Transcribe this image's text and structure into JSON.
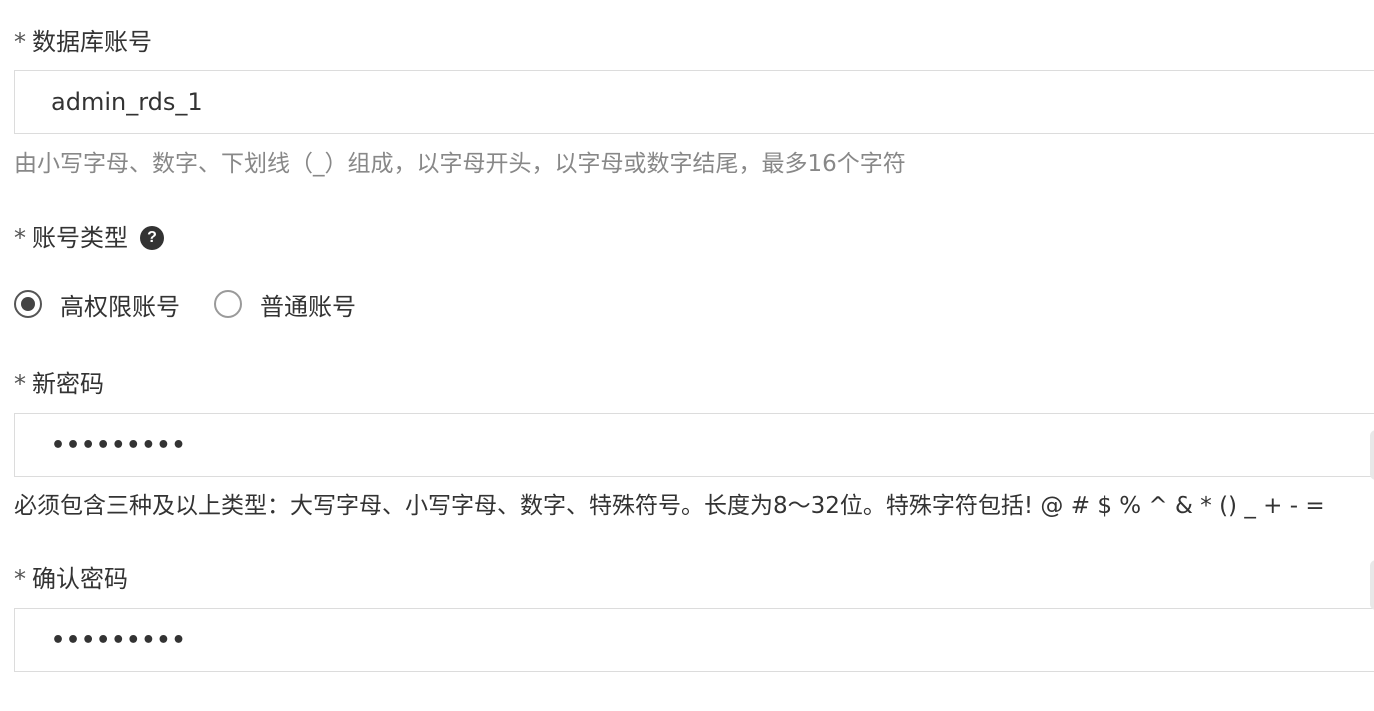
{
  "form": {
    "account": {
      "required_mark": "*",
      "label": "数据库账号",
      "value": "admin_rds_1",
      "hint": "由小写字母、数字、下划线（_）组成，以字母开头，以字母或数字结尾，最多16个字符"
    },
    "account_type": {
      "required_mark": "*",
      "label": "账号类型",
      "help_icon": "question-circle-icon",
      "options": [
        {
          "label": "高权限账号",
          "checked": true
        },
        {
          "label": "普通账号",
          "checked": false
        }
      ]
    },
    "new_password": {
      "required_mark": "*",
      "label": "新密码",
      "value": "•••••••••",
      "hint": "必须包含三种及以上类型：大写字母、小写字母、数字、特殊符号。长度为8～32位。特殊字符包括! @ # $ % ^ & * () _ + - ="
    },
    "confirm_password": {
      "required_mark": "*",
      "label": "确认密码",
      "value": "•••••••••"
    }
  }
}
